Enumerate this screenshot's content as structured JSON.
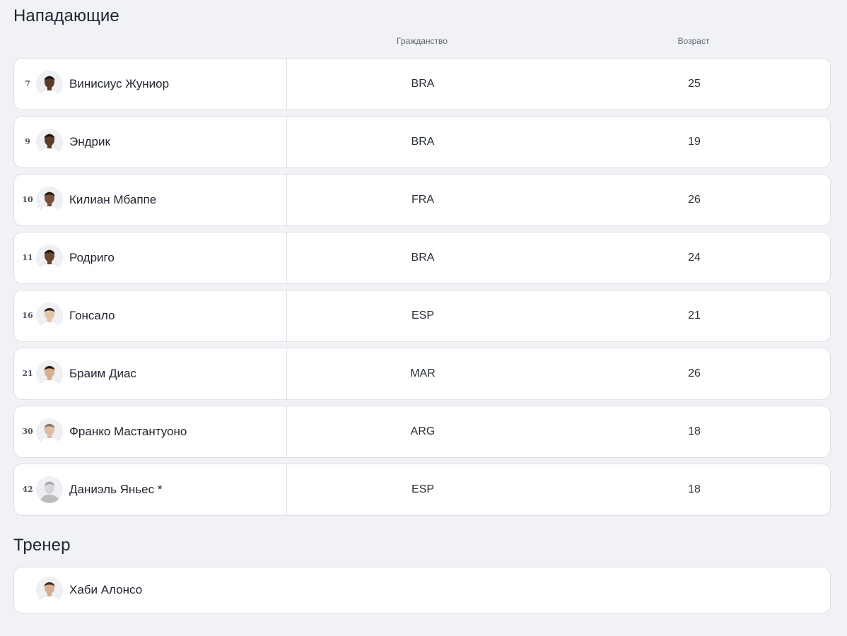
{
  "sections": {
    "forwards_title": "Нападающие",
    "coach_title": "Тренер"
  },
  "columns": {
    "nationality": "Гражданство",
    "age": "Возраст"
  },
  "players": [
    {
      "number": "7",
      "name": "Винисиус Жуниор",
      "nationality": "BRA",
      "age": "25",
      "skin": "#5a3a28",
      "hair": "#1a1411"
    },
    {
      "number": "9",
      "name": "Эндрик",
      "nationality": "BRA",
      "age": "19",
      "skin": "#5e3e2b",
      "hair": "#1a1411"
    },
    {
      "number": "10",
      "name": "Килиан Мбаппе",
      "nationality": "FRA",
      "age": "26",
      "skin": "#7a5038",
      "hair": "#1d1712"
    },
    {
      "number": "11",
      "name": "Родриго",
      "nationality": "BRA",
      "age": "24",
      "skin": "#6a452f",
      "hair": "#1a1411"
    },
    {
      "number": "16",
      "name": "Гонсало",
      "nationality": "ESP",
      "age": "21",
      "skin": "#e7c3a6",
      "hair": "#2b1f18"
    },
    {
      "number": "21",
      "name": "Браим Диас",
      "nationality": "MAR",
      "age": "26",
      "skin": "#d9ae8c",
      "hair": "#1f1813"
    },
    {
      "number": "30",
      "name": "Франко Мастантуоно",
      "nationality": "ARG",
      "age": "18",
      "skin": "#e2bca0",
      "hair": "#8b7766"
    },
    {
      "number": "42",
      "name": "Даниэль Яньес *",
      "nationality": "ESP",
      "age": "18",
      "skin": "#d4d4d6",
      "hair": "#a9a9ad"
    }
  ],
  "coach": {
    "name": "Хаби Алонсо",
    "skin": "#d9ae8c",
    "hair": "#3a2a20"
  }
}
